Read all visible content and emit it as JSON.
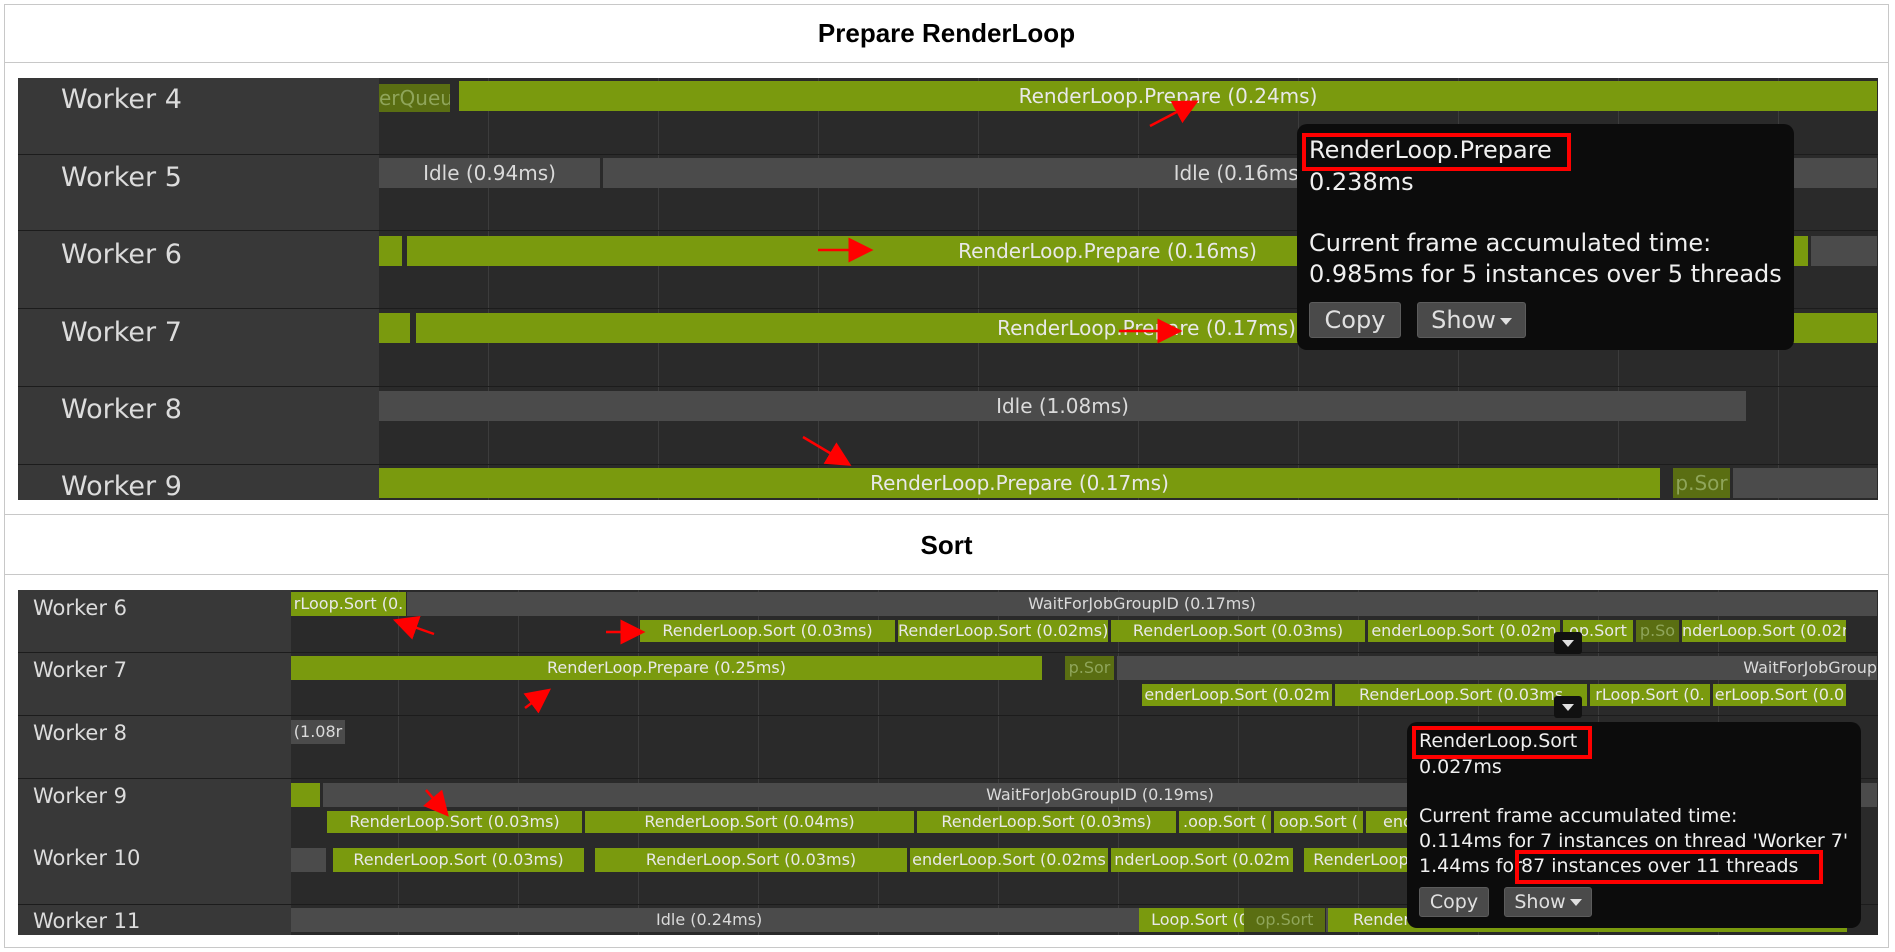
{
  "sections": {
    "prepare": {
      "title": "Prepare RenderLoop"
    },
    "sort": {
      "title": "Sort"
    }
  },
  "prepare_panel": {
    "threads": [
      "Worker 4",
      "Worker 5",
      "Worker 6",
      "Worker 7",
      "Worker 8",
      "Worker 9"
    ],
    "bars": [
      {
        "text": "erQueue",
        "style": "dim"
      },
      {
        "text": "RenderLoop.Prepare (0.24ms)",
        "style": "green"
      },
      {
        "text": "Idle (0.94ms)",
        "style": "gray"
      },
      {
        "text": "Idle (0.16ms)",
        "style": "gray"
      },
      {
        "text": "",
        "style": "green"
      },
      {
        "text": "RenderLoop.Prepare (0.16ms)",
        "style": "green"
      },
      {
        "text": "",
        "style": "gray"
      },
      {
        "text": "",
        "style": "green"
      },
      {
        "text": "RenderLoop.Prepare (0.17ms)",
        "style": "green"
      },
      {
        "text": "Idle (1.08ms)",
        "style": "gray"
      },
      {
        "text": "RenderLoop.Prepare (0.17ms)",
        "style": "green"
      },
      {
        "text": "p.Sor",
        "style": "dim"
      },
      {
        "text": "",
        "style": "gray"
      }
    ],
    "tooltip": {
      "name": "RenderLoop.Prepare",
      "duration": "0.238ms",
      "accum_label": "Current frame accumulated time:",
      "accum_value": "0.985ms for 5 instances over 5 threads",
      "copy": "Copy",
      "show": "Show"
    }
  },
  "sort_panel": {
    "threads": [
      "Worker 6",
      "Worker 7",
      "Worker 8",
      "Worker 9",
      "Worker 10",
      "Worker 11"
    ],
    "bars": [
      {
        "text": "rLoop.Sort (0.",
        "style": "green"
      },
      {
        "text": "WaitForJobGroupID (0.17ms)",
        "style": "gray"
      },
      {
        "text": "RenderLoop.Sort (0.03ms)",
        "style": "green"
      },
      {
        "text": "RenderLoop.Sort (0.02ms)",
        "style": "green"
      },
      {
        "text": "RenderLoop.Sort (0.03ms)",
        "style": "green"
      },
      {
        "text": "enderLoop.Sort (0.02m",
        "style": "green"
      },
      {
        "text": "op.Sort",
        "style": "green"
      },
      {
        "text": "p.So",
        "style": "dim"
      },
      {
        "text": "nderLoop.Sort (0.02r",
        "style": "green"
      },
      {
        "text": "RenderLoop.Prepare (0.25ms)",
        "style": "green"
      },
      {
        "text": "p.Sor",
        "style": "dim"
      },
      {
        "text": "WaitForJobGroup",
        "style": "gray"
      },
      {
        "text": "enderLoop.Sort (0.02m",
        "style": "green"
      },
      {
        "text": "RenderLoop.Sort (0.03ms",
        "style": "green"
      },
      {
        "text": "rLoop.Sort (0.",
        "style": "green"
      },
      {
        "text": "erLoop.Sort (0.0",
        "style": "green"
      },
      {
        "text": "(1.08r",
        "style": "gray"
      },
      {
        "text": "",
        "style": "green"
      },
      {
        "text": "WaitForJobGroupID (0.19ms)",
        "style": "gray"
      },
      {
        "text": "RenderLoop.Sort (0.03ms)",
        "style": "green"
      },
      {
        "text": "RenderLoop.Sort (0.04ms)",
        "style": "green"
      },
      {
        "text": "RenderLoop.Sort (0.03ms)",
        "style": "green"
      },
      {
        "text": ".oop.Sort (",
        "style": "green"
      },
      {
        "text": "oop.Sort (",
        "style": "green"
      },
      {
        "text": "enderLo",
        "style": "green"
      },
      {
        "text": "",
        "style": "gray"
      },
      {
        "text": "RenderLoop.Sort (0.03ms)",
        "style": "green"
      },
      {
        "text": "RenderLoop.Sort (0.03ms)",
        "style": "green"
      },
      {
        "text": "enderLoop.Sort (0.02ms",
        "style": "green"
      },
      {
        "text": "nderLoop.Sort (0.02m",
        "style": "green"
      },
      {
        "text": "RenderLoop.",
        "style": "green"
      },
      {
        "text": "Idle (0.24ms)",
        "style": "gray"
      },
      {
        "text": "Loop.Sort (0",
        "style": "green"
      },
      {
        "text": "op.Sort",
        "style": "dim"
      },
      {
        "text": "RenderLo",
        "style": "green"
      }
    ],
    "tooltip": {
      "name": "RenderLoop.Sort",
      "duration": "0.027ms",
      "accum_label": "Current frame accumulated time:",
      "accum_thread": "0.114ms for 7 instances on thread 'Worker 7'",
      "accum_all_prefix": "1.44ms for",
      "accum_all_highlight": "87 instances over 11 threads",
      "copy": "Copy",
      "show": "Show"
    }
  },
  "colors": {
    "bar_green": "#7a9a0e",
    "bar_gray": "#4b4b4b",
    "panel_bg": "#2a2a2a",
    "label_bg": "#383838",
    "tooltip_bg": "#0c0c0c",
    "annotation_red": "#ff0000"
  },
  "icons": [
    "red-arrow-icon",
    "dropdown-caret-icon",
    "expander-icon"
  ]
}
